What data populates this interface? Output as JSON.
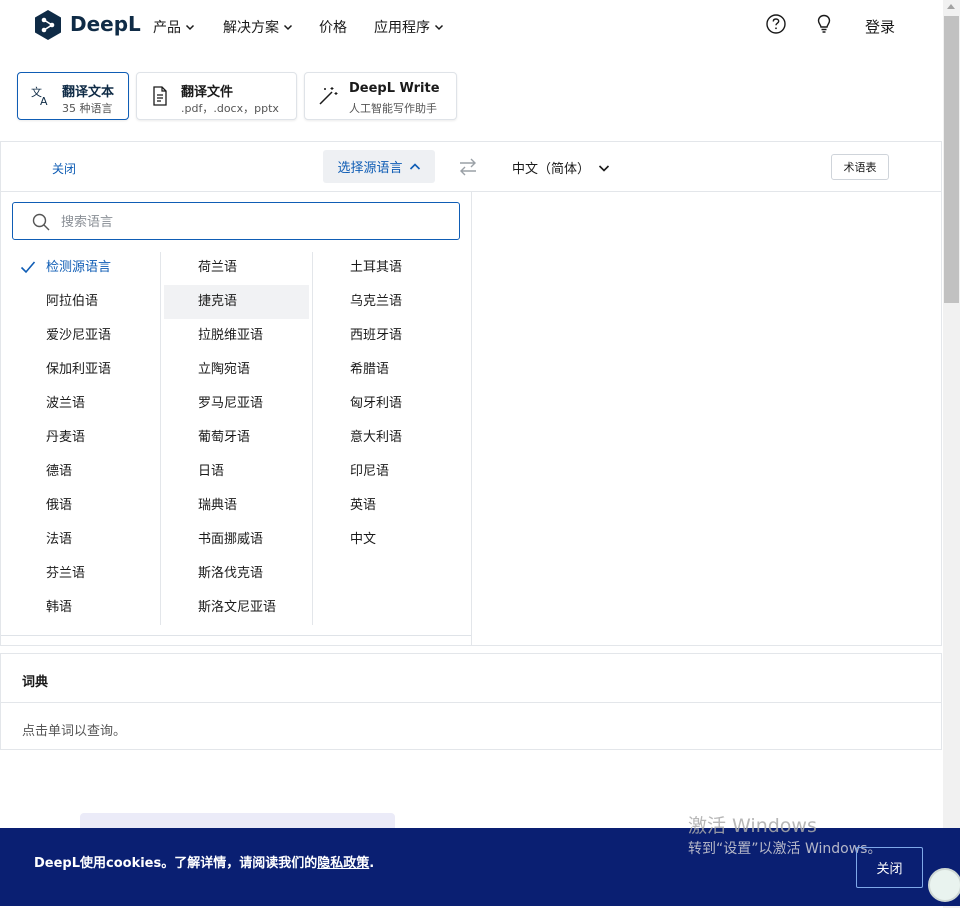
{
  "brand": {
    "name": "DeepL"
  },
  "nav": {
    "items": [
      {
        "label": "产品",
        "has_menu": true
      },
      {
        "label": "解决方案",
        "has_menu": true
      },
      {
        "label": "价格",
        "has_menu": false
      },
      {
        "label": "应用程序",
        "has_menu": true
      }
    ],
    "login_label": "登录",
    "icons": [
      "help-icon",
      "lightbulb-icon"
    ]
  },
  "mode_tabs": [
    {
      "title": "翻译文本",
      "subtitle": "35 种语言",
      "active": true,
      "icon": "translate-icon"
    },
    {
      "title": "翻译文件",
      "subtitle": ".pdf，.docx，pptx",
      "active": false,
      "icon": "document-icon"
    },
    {
      "title": "DeepL Write",
      "subtitle": "人工智能写作助手",
      "active": false,
      "icon": "magic-wand-icon"
    }
  ],
  "translator": {
    "close_label": "关闭",
    "source_button_label": "选择源语言",
    "target_language": "中文（简体）",
    "glossary_label": "术语表"
  },
  "language_dropdown": {
    "search_placeholder": "搜索语言",
    "selected": "检测源语言",
    "hovered": "捷克语",
    "columns": [
      [
        "检测源语言",
        "阿拉伯语",
        "爱沙尼亚语",
        "保加利亚语",
        "波兰语",
        "丹麦语",
        "德语",
        "俄语",
        "法语",
        "芬兰语",
        "韩语"
      ],
      [
        "荷兰语",
        "捷克语",
        "拉脱维亚语",
        "立陶宛语",
        "罗马尼亚语",
        "葡萄牙语",
        "日语",
        "瑞典语",
        "书面挪威语",
        "斯洛伐克语",
        "斯洛文尼亚语"
      ],
      [
        "土耳其语",
        "乌克兰语",
        "西班牙语",
        "希腊语",
        "匈牙利语",
        "意大利语",
        "印尼语",
        "英语",
        "中文"
      ]
    ]
  },
  "dictionary": {
    "title": "词典",
    "hint": "点击单词以查询。"
  },
  "cookie_banner": {
    "text_prefix": "DeepL使用cookies。了解详情，请阅读我们的",
    "link_label": "隐私政策",
    "text_suffix": ".",
    "close_label": "关闭"
  },
  "windows_watermark": {
    "line1": "激活 Windows",
    "line2": "转到“设置”以激活 Windows。"
  },
  "colors": {
    "accent": "#0f5db5",
    "brand_dark": "#0f2b46",
    "cookie_bg": "#0a1f72"
  }
}
